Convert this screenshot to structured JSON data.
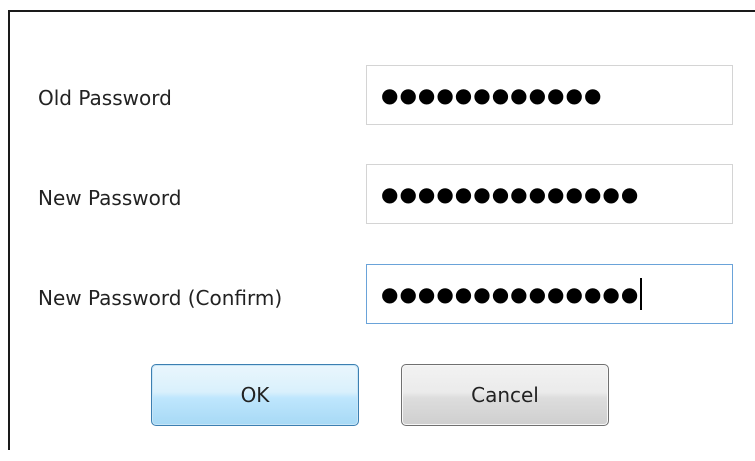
{
  "form": {
    "old_password": {
      "label": "Old Password",
      "masked_value": "●●●●●●●●●●●●"
    },
    "new_password": {
      "label": "New Password",
      "masked_value": "●●●●●●●●●●●●●●"
    },
    "confirm_password": {
      "label": "New Password (Confirm)",
      "masked_value": "●●●●●●●●●●●●●●"
    }
  },
  "buttons": {
    "ok_label": "OK",
    "cancel_label": "Cancel"
  },
  "colors": {
    "focus_border": "#6aa3d9",
    "ok_border": "#3c7fb1",
    "cancel_border": "#707070"
  }
}
